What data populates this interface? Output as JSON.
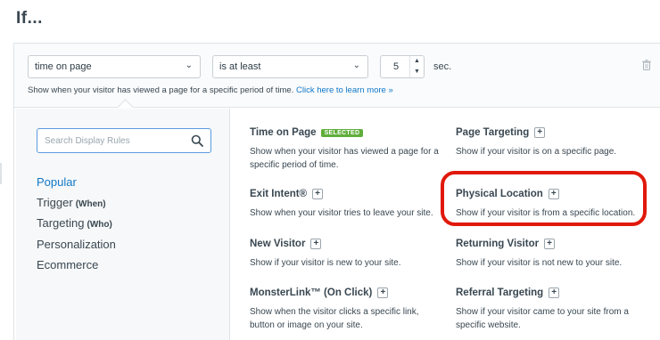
{
  "page_title": "If...",
  "condition": {
    "label": "time on page",
    "icon": "chevron-down-icon"
  },
  "operator": {
    "label": "is at least",
    "icon": "chevron-down-icon"
  },
  "number_value": "5",
  "unit": "sec.",
  "description": {
    "text": "Show when your visitor has viewed a page for a specific period of time.",
    "link": "Click here to learn more »"
  },
  "search": {
    "placeholder": "Search Display Rules",
    "icon": "search-icon"
  },
  "categories": [
    {
      "label": "Popular",
      "sub": ""
    },
    {
      "label": "Trigger",
      "sub": "(When)"
    },
    {
      "label": "Targeting",
      "sub": "(Who)"
    },
    {
      "label": "Personalization",
      "sub": ""
    },
    {
      "label": "Ecommerce",
      "sub": ""
    }
  ],
  "rules": [
    {
      "name": "Time on Page",
      "badge": "SELECTED",
      "text": "Show when your visitor has viewed a page for a specific period of time."
    },
    {
      "name": "Page Targeting",
      "text": "Show if your visitor is on a specific page."
    },
    {
      "name": "Exit Intent®",
      "text": "Show when your visitor tries to leave your site."
    },
    {
      "name": "Physical Location",
      "text": "Show if your visitor is from a specific location."
    },
    {
      "name": "New Visitor",
      "text": "Show if your visitor is new to your site."
    },
    {
      "name": "Returning Visitor",
      "text": "Show if your visitor is not new to your site."
    },
    {
      "name": "MonsterLink™ (On Click)",
      "text": "Show when the visitor clicks a specific link, button or image on your site."
    },
    {
      "name": "Referral Targeting",
      "text": "Show if your visitor came to your site from a specific website."
    }
  ],
  "colors": {
    "accent": "#0f78c8",
    "selected_badge": "#5fae3b",
    "highlight": "#e0190b"
  }
}
